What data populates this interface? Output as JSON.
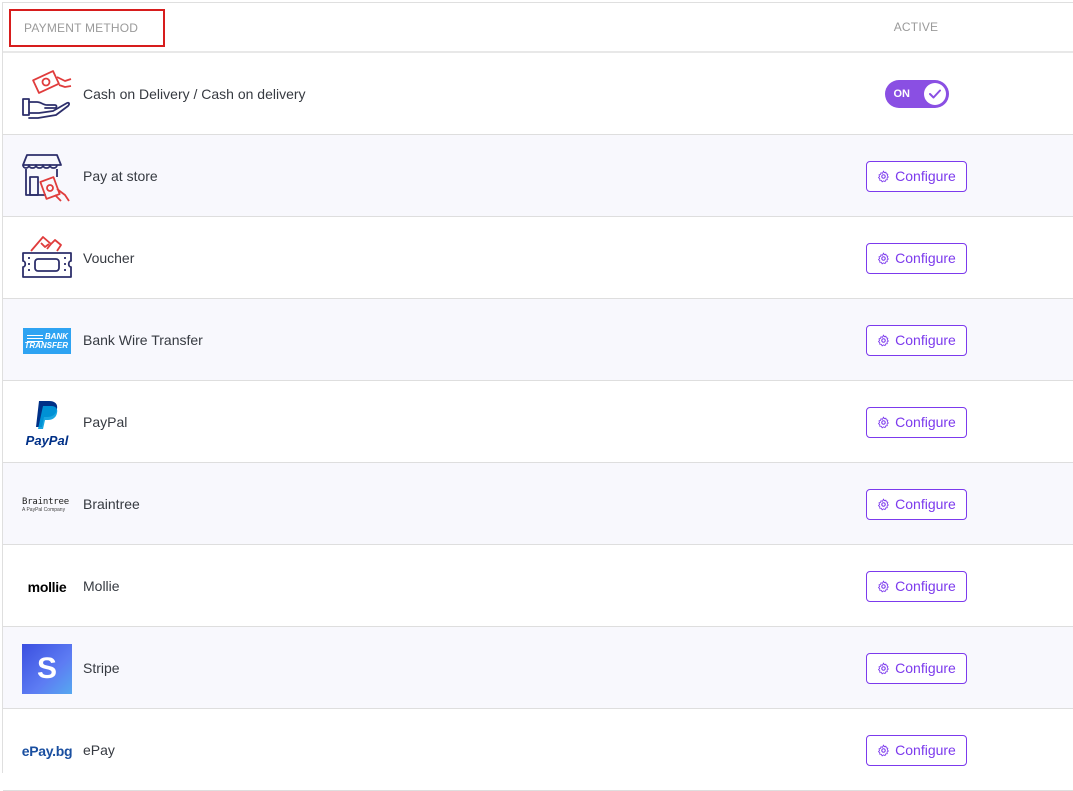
{
  "header": {
    "payment_method": "PAYMENT METHOD",
    "active": "ACTIVE"
  },
  "rows": [
    {
      "name": "Cash on Delivery / Cash on delivery",
      "icon": "cash-on-delivery-icon",
      "state": "ON"
    },
    {
      "name": "Pay at store",
      "icon": "store-icon",
      "action": "Configure"
    },
    {
      "name": "Voucher",
      "icon": "voucher-icon",
      "action": "Configure"
    },
    {
      "name": "Bank Wire Transfer",
      "icon": "bank-transfer-logo",
      "action": "Configure",
      "logo_text": [
        "BANK",
        "TRANSFER"
      ]
    },
    {
      "name": "PayPal",
      "icon": "paypal-logo",
      "action": "Configure",
      "logo_text": "PayPal"
    },
    {
      "name": "Braintree",
      "icon": "braintree-logo",
      "action": "Configure",
      "logo_text": "Braintree",
      "logo_sub": "A PayPal Company"
    },
    {
      "name": "Mollie",
      "icon": "mollie-logo",
      "action": "Configure",
      "logo_text": "mollie"
    },
    {
      "name": "Stripe",
      "icon": "stripe-logo",
      "action": "Configure",
      "logo_text": "S"
    },
    {
      "name": "ePay",
      "icon": "epay-logo",
      "action": "Configure",
      "logo_text": "ePay.bg"
    }
  ],
  "colors": {
    "accent": "#7c3aed",
    "toggle": "#8a4fe3",
    "icon_red": "#e03c3c",
    "icon_navy": "#2d2f6b",
    "highlight_border": "#d71d1d"
  }
}
